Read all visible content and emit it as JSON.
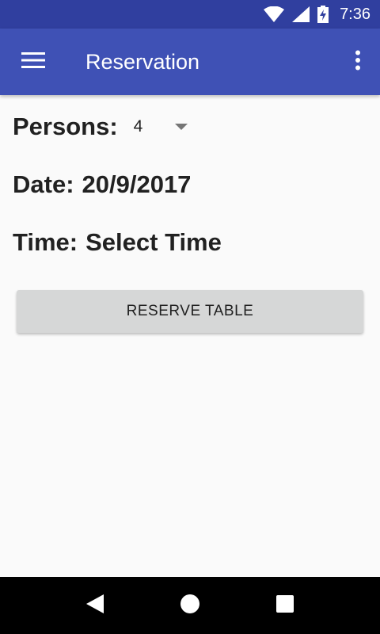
{
  "status_bar": {
    "time": "7:36",
    "icons": [
      "wifi-icon",
      "cell-signal-icon",
      "battery-charging-icon"
    ]
  },
  "app_bar": {
    "title": "Reservation",
    "menu_icon": "hamburger-menu-icon",
    "overflow_icon": "more-vert-icon",
    "color": "#3f51b5",
    "status_color": "#303f9f"
  },
  "form": {
    "persons_label": "Persons:",
    "persons_value": "4",
    "date_label": "Date:",
    "date_value": "20/9/2017",
    "time_label": "Time:",
    "time_value": "Select Time",
    "reserve_button": "RESERVE TABLE"
  },
  "nav_bar": {
    "buttons": [
      "back-icon",
      "home-icon",
      "recents-icon"
    ]
  }
}
